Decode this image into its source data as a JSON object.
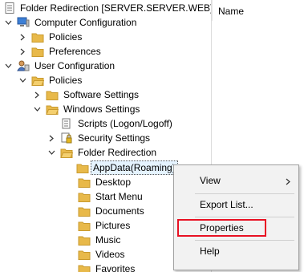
{
  "tree": {
    "items": [
      {
        "label": "Folder Redirection [SERVER.SERVER.WEB]"
      },
      {
        "label": "Computer Configuration"
      },
      {
        "label": "Policies"
      },
      {
        "label": "Preferences"
      },
      {
        "label": "User Configuration"
      },
      {
        "label": "Policies"
      },
      {
        "label": "Software Settings"
      },
      {
        "label": "Windows Settings"
      },
      {
        "label": "Scripts (Logon/Logoff)"
      },
      {
        "label": "Security Settings"
      },
      {
        "label": "Folder Redirection"
      },
      {
        "label": "AppData(Roaming)"
      },
      {
        "label": "Desktop"
      },
      {
        "label": "Start Menu"
      },
      {
        "label": "Documents"
      },
      {
        "label": "Pictures"
      },
      {
        "label": "Music"
      },
      {
        "label": "Videos"
      },
      {
        "label": "Favorites"
      }
    ]
  },
  "list_header": {
    "name": "Name"
  },
  "context_menu": {
    "items": [
      {
        "label": "View",
        "has_submenu": true
      },
      {
        "label": "Export List..."
      },
      {
        "label": "Properties",
        "highlighted": true
      },
      {
        "label": "Help"
      }
    ]
  },
  "colors": {
    "folder": "#e8b94a",
    "highlight": "#e81123",
    "selection": "#e5f3ff"
  }
}
